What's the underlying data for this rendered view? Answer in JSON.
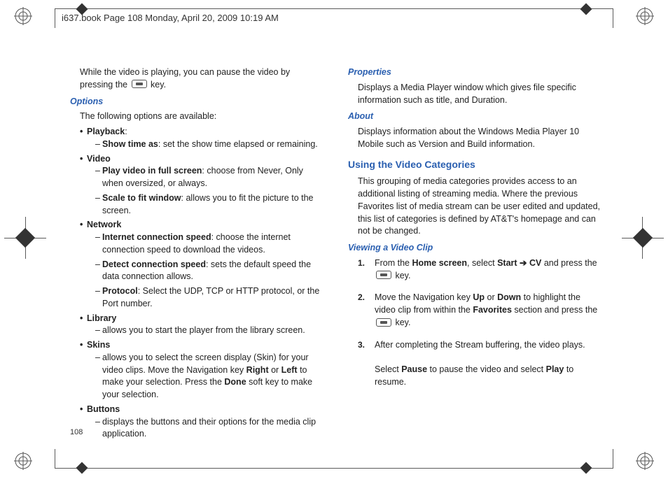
{
  "header": {
    "stamp": "i637.book  Page 108  Monday, April 20, 2009  10:19 AM"
  },
  "page_number": "108",
  "left": {
    "intro_a": "While the video is playing, you can pause the video by pressing the ",
    "intro_b": " key.",
    "options_head": "Options",
    "options_intro": "The following options are available:",
    "playback": {
      "label": "Playback",
      "items": [
        {
          "label": "Show time as",
          "desc": ": set the show time elapsed or remaining."
        }
      ]
    },
    "video": {
      "label": "Video",
      "items": [
        {
          "label": "Play video in full screen",
          "desc": ": choose from Never, Only when oversized, or always."
        },
        {
          "label": "Scale to fit window",
          "desc": ": allows you to fit the picture to the screen."
        }
      ]
    },
    "network": {
      "label": "Network",
      "items": [
        {
          "label": "Internet connection speed",
          "desc": ": choose the internet connection speed to download the videos."
        },
        {
          "label": "Detect connection speed",
          "desc": ": sets the default speed the data connection allows."
        },
        {
          "label": "Protocol",
          "desc": ": Select the UDP, TCP or HTTP protocol, or the Port number."
        }
      ]
    },
    "library": {
      "label": "Library",
      "items": [
        {
          "label": "",
          "desc": "allows you to start the player from the library screen."
        }
      ]
    },
    "skins": {
      "label": "Skins",
      "items": [
        {
          "label": "",
          "desc_a": "allows you to select the screen display (Skin) for your video clips. Move the Navigation key ",
          "right": "Right",
          "or": " or ",
          "left": "Left",
          "desc_b": " to make your selection. Press the ",
          "done": "Done",
          "desc_c": " soft key to make your selection."
        }
      ]
    },
    "buttons": {
      "label": "Buttons",
      "items": [
        {
          "label": "",
          "desc": "displays the buttons and their options for the media clip application."
        }
      ]
    }
  },
  "right": {
    "properties_head": "Properties",
    "properties_body": "Displays a Media Player window which gives file specific information such as title, and Duration.",
    "about_head": "About",
    "about_body": "Displays information about the Windows Media Player 10 Mobile such as Version and Build information.",
    "cats_head": "Using the Video Categories",
    "cats_body": "This grouping of media categories provides access to an additional listing of streaming media. Where the previous Favorites list of media stream can be user edited and updated, this list of categories is defined by AT&T's homepage and can not be changed.",
    "view_head": "Viewing a Video Clip",
    "steps": [
      {
        "n": "1.",
        "a": "From the ",
        "home": "Home screen",
        "b": ", select ",
        "start": "Start",
        "arrow": " ➔ ",
        "cv": "CV",
        "c": " and press the ",
        "d": " key."
      },
      {
        "n": "2.",
        "a": "Move the Navigation key ",
        "up": "Up",
        "or": " or ",
        "down": "Down",
        "b": " to highlight the video clip from within the ",
        "fav": "Favorites",
        "c": " section and press the ",
        "d": " key."
      },
      {
        "n": "3.",
        "a": "After completing the Stream buffering, the video plays.",
        "b": "Select ",
        "pause": "Pause",
        "c": " to pause the video and select ",
        "play": "Play",
        "d": " to resume."
      }
    ]
  }
}
